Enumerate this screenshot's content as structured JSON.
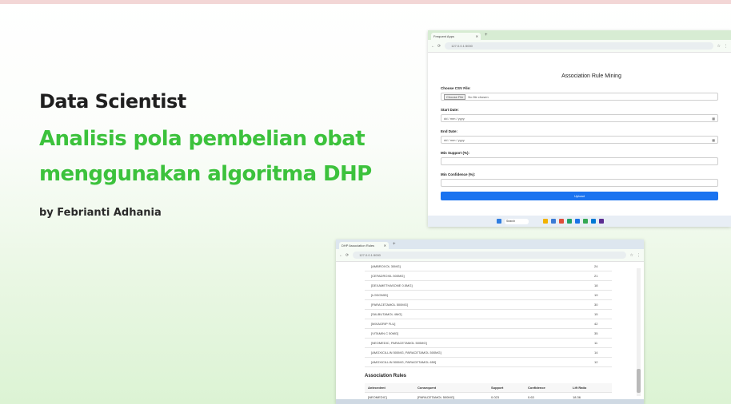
{
  "hero": {
    "role": "Data Scientist",
    "line1": "Analisis pola pembelian obat",
    "line2": "menggunakan algoritma DHP",
    "author": "by Febrianti Adhania"
  },
  "window1": {
    "tab_title": "Frequent Apps",
    "url": "127.0.0.1:5000",
    "page_title": "Association Rule Mining",
    "file_label": "Choose CSV File:",
    "file_button": "Choose File",
    "file_status": "No file chosen",
    "start_label": "Start Date:",
    "start_value": "dd / mm / yyyy",
    "end_label": "End Date:",
    "end_value": "dd / mm / yyyy",
    "support_label": "Min Support (%):",
    "confidence_label": "Min Confidence (%):",
    "upload_label": "Upload",
    "taskbar_search": "Search"
  },
  "window2": {
    "tab_title": "DHP Association Rules",
    "url": "127.0.0.1:5000",
    "itemsets": [
      {
        "item": "[AMBROXOL 30MG]",
        "count": "24"
      },
      {
        "item": "[CEFADROXIL 500MG]",
        "count": "21"
      },
      {
        "item": "[DEXAMETHASONE 0.5MG]",
        "count": "18"
      },
      {
        "item": "[LODOMID]",
        "count": "19"
      },
      {
        "item": "[PARACETAMOL 500MG]",
        "count": "30"
      },
      {
        "item": "[SALBUTAMOL 4MG]",
        "count": "15"
      },
      {
        "item": "[MIXAGRIP FLU]",
        "count": "42"
      },
      {
        "item": "[VITAMIN C 50MG]",
        "count": "35"
      },
      {
        "item": "[NEOMEDIC, PARACETAMOL 500MG]",
        "count": "11"
      },
      {
        "item": "[AMOXICILLIN 500MG, PARACETAMOL 500MG]",
        "count": "14"
      },
      {
        "item": "[AMOXICILLIN 500MG, PARACETAMOL 650]",
        "count": "12"
      }
    ],
    "rules_title": "Association Rules",
    "rules_headers": [
      "Antecedent",
      "Consequent",
      "Support",
      "Confidence",
      "Lift Ratio"
    ],
    "rules_rows": [
      [
        "[NEOMEDIC]",
        "[PARACETAMOL 500MG]",
        "0.023",
        "0.63",
        "18.36"
      ]
    ]
  },
  "colors": {
    "accent_green": "#3cc23c",
    "heading_dark": "#1f1f1f",
    "upload_blue": "#1a73f0"
  }
}
